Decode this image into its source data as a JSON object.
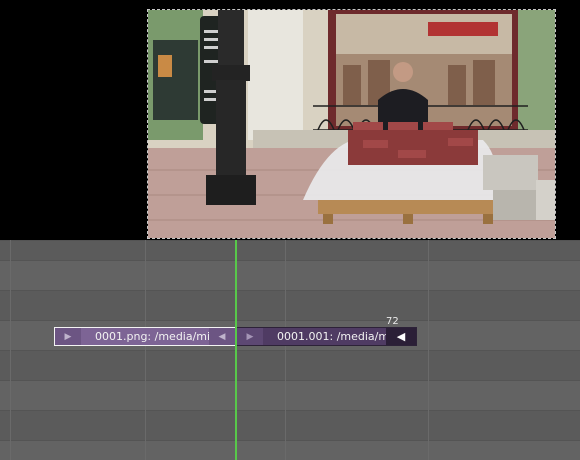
{
  "preview": {
    "image_description_icon": "video-frame-image"
  },
  "sequencer": {
    "current_frame": "72",
    "strips": [
      {
        "label": "0001.png: /media/mi",
        "left_handle_icon": "triangle-right-icon",
        "right_handle_icon": "triangle-left-icon",
        "color": "#7d6495",
        "selected": true
      },
      {
        "label": "0001.001: /media/m",
        "left_handle_icon": "triangle-right-icon",
        "right_handle_icon": "triangle-left-icon",
        "color": "#4f3b63",
        "selected": false
      }
    ],
    "playhead_color": "#58c84a"
  }
}
